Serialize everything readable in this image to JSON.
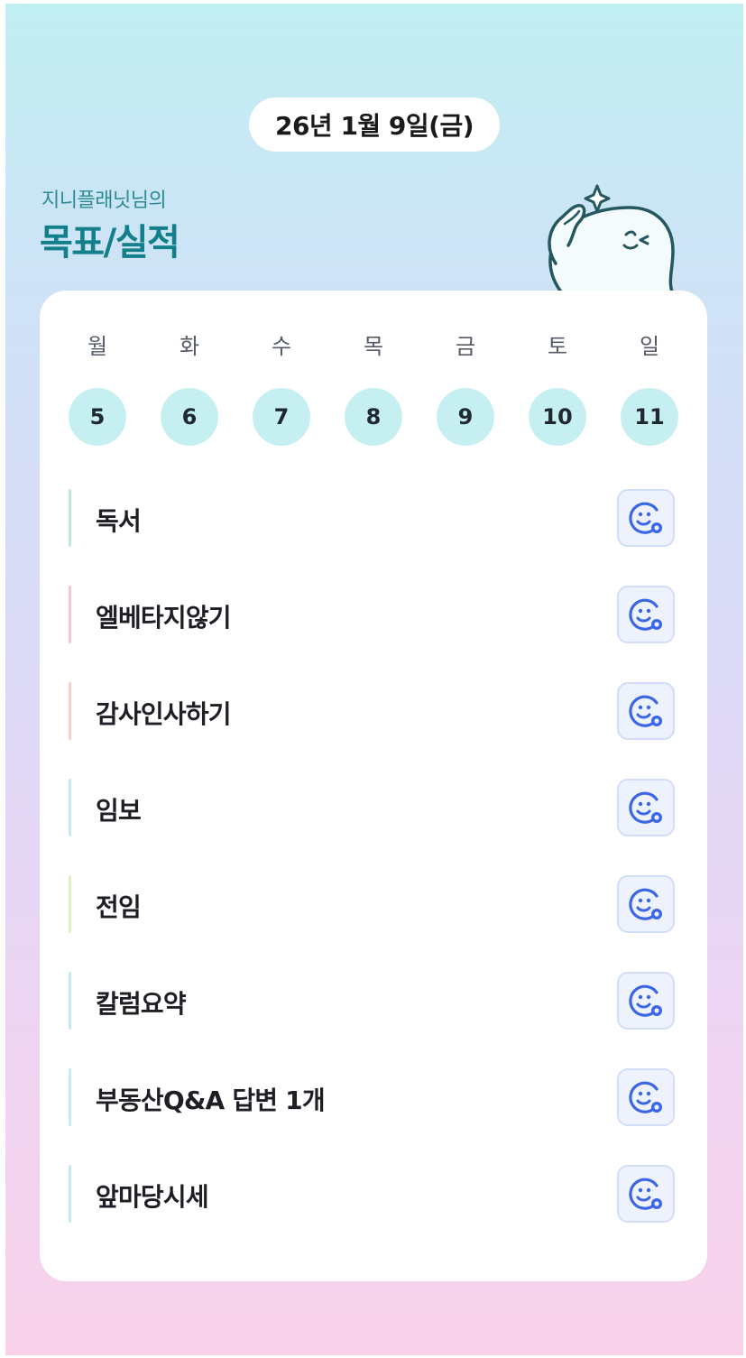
{
  "date_label": "26년 1월 9일(금)",
  "owner_label": "지니플래닛님의",
  "section_title": "목표/실적",
  "weekdays": [
    "월",
    "화",
    "수",
    "목",
    "금",
    "토",
    "일"
  ],
  "days": [
    "5",
    "6",
    "7",
    "8",
    "9",
    "10",
    "11"
  ],
  "goals": [
    {
      "label": "독서",
      "bar_color": "#bfe9d9"
    },
    {
      "label": "엘베타지않기",
      "bar_color": "#f6c6df"
    },
    {
      "label": "감사인사하기",
      "bar_color": "#f5d2c7"
    },
    {
      "label": "임보",
      "bar_color": "#c6e9f2"
    },
    {
      "label": "전임",
      "bar_color": "#def0c0"
    },
    {
      "label": "칼럼요약",
      "bar_color": "#c6e9f2"
    },
    {
      "label": "부동산Q&A 답변 1개",
      "bar_color": "#c6e9f2"
    },
    {
      "label": "앞마당시세",
      "bar_color": "#c6e9f2"
    }
  ],
  "icons": {
    "mascot": "mascot-illustration",
    "goal_action": "smile-add-icon"
  },
  "colors": {
    "accent": "#127f8a",
    "day_circle": "#c6eff2",
    "icon_blue": "#3b66e6"
  }
}
